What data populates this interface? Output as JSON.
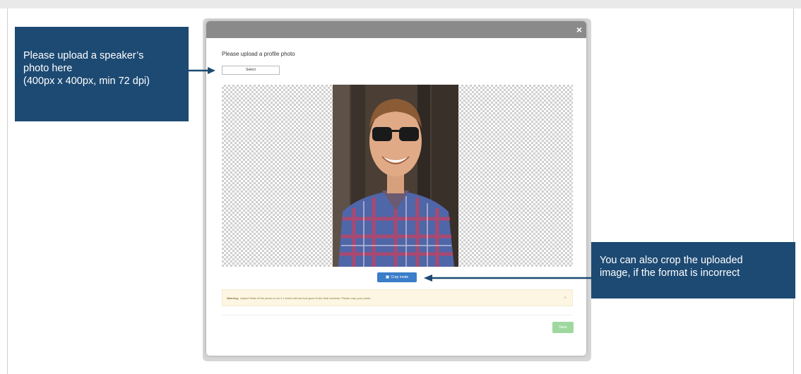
{
  "modal": {
    "close_glyph": "×",
    "title": "Please upload a profile photo",
    "select_label": "Select",
    "crop_label": "Crop mode",
    "crop_icon": "crop-icon",
    "warning_bold": "Warning:",
    "warning_text": "Aspect Ratio of the photo is not 1:1 which will not look good in the final contents. Please crop your photo.",
    "warning_close": "×",
    "save_label": "Save"
  },
  "callouts": {
    "left": {
      "line1": "Please upload a speaker’s",
      "line2": "photo here",
      "line3": "(400px x 400px, min 72 dpi)"
    },
    "right": {
      "line1": "You can also crop the uploaded",
      "line2": "image, if the format is incorrect"
    }
  },
  "colors": {
    "callout_bg": "#1d4a73",
    "crop_button": "#3a7dc9",
    "save_button": "#9fd89f",
    "warning_bg": "#fcf6e3"
  }
}
